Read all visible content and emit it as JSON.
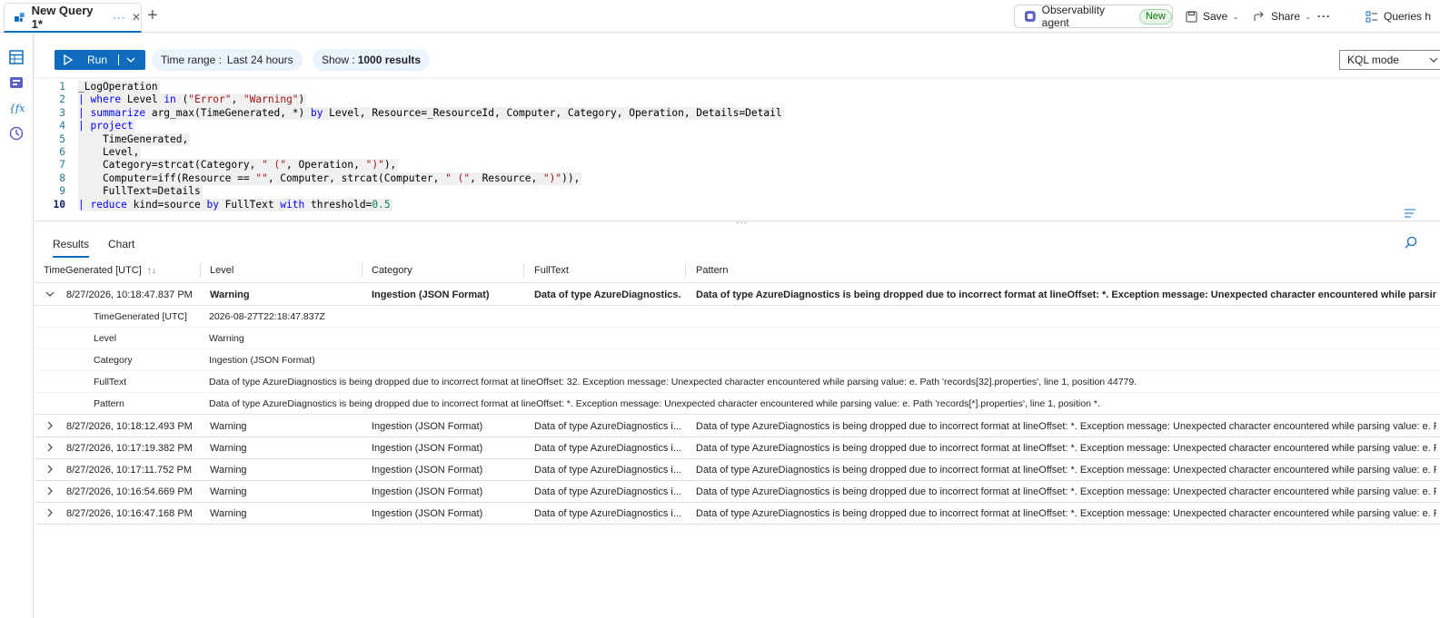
{
  "tab": {
    "title": "New Query 1*",
    "dots": "···",
    "close": "✕",
    "add": "+"
  },
  "header": {
    "agent_label": "Observability agent",
    "agent_badge": "New",
    "save_label": "Save",
    "share_label": "Share",
    "more": "···",
    "queries_label": "Queries h"
  },
  "toolbar": {
    "run_label": "Run",
    "time_range_label": "Time range :",
    "time_range_value": "Last 24 hours",
    "show_label": "Show :",
    "show_value": "1000 results",
    "mode_label": "KQL mode"
  },
  "editor": {
    "line_numbers": [
      "1",
      "2",
      "3",
      "4",
      "5",
      "6",
      "7",
      "8",
      "9",
      "10"
    ]
  },
  "results": {
    "tabs": [
      "Results",
      "Chart"
    ],
    "columns": [
      "TimeGenerated [UTC]",
      "Level",
      "Category",
      "FullText",
      "Pattern"
    ],
    "sort_icon": "↑↓",
    "expanded_row": {
      "time": "8/27/2026, 10:18:47.837 PM",
      "level": "Warning",
      "category": "Ingestion (JSON Format)",
      "fulltext": "Data of type AzureDiagnostics...",
      "pattern": "Data of type AzureDiagnostics is being dropped due to incorrect format at lineOffset: *. Exception message: Unexpected character encountered while parsing valu..."
    },
    "details": [
      {
        "key": "TimeGenerated [UTC]",
        "value": "2026-08-27T22:18:47.837Z"
      },
      {
        "key": "Level",
        "value": "Warning"
      },
      {
        "key": "Category",
        "value": "Ingestion (JSON Format)"
      },
      {
        "key": "FullText",
        "value": "Data of type AzureDiagnostics is being dropped due to incorrect format at lineOffset: 32. Exception message: Unexpected character encountered while parsing value: e. Path 'records[32].properties', line 1, position 44779."
      },
      {
        "key": "Pattern",
        "value": "Data of type AzureDiagnostics is being dropped due to incorrect format at lineOffset: *. Exception message: Unexpected character encountered while parsing value: e. Path 'records[*].properties', line 1, position *."
      }
    ],
    "rows": [
      {
        "time": "8/27/2026, 10:18:12.493 PM",
        "level": "Warning",
        "category": "Ingestion (JSON Format)",
        "fulltext": "Data of type AzureDiagnostics i...",
        "pattern": "Data of type AzureDiagnostics is being dropped due to incorrect format at lineOffset: *. Exception message: Unexpected character encountered while parsing value: e. P..."
      },
      {
        "time": "8/27/2026, 10:17:19.382 PM",
        "level": "Warning",
        "category": "Ingestion (JSON Format)",
        "fulltext": "Data of type AzureDiagnostics i...",
        "pattern": "Data of type AzureDiagnostics is being dropped due to incorrect format at lineOffset: *. Exception message: Unexpected character encountered while parsing value: e. P..."
      },
      {
        "time": "8/27/2026, 10:17:11.752 PM",
        "level": "Warning",
        "category": "Ingestion (JSON Format)",
        "fulltext": "Data of type AzureDiagnostics i...",
        "pattern": "Data of type AzureDiagnostics is being dropped due to incorrect format at lineOffset: *. Exception message: Unexpected character encountered while parsing value: e. P..."
      },
      {
        "time": "8/27/2026, 10:16:54.669 PM",
        "level": "Warning",
        "category": "Ingestion (JSON Format)",
        "fulltext": "Data of type AzureDiagnostics i...",
        "pattern": "Data of type AzureDiagnostics is being dropped due to incorrect format at lineOffset: *. Exception message: Unexpected character encountered while parsing value: e. P..."
      },
      {
        "time": "8/27/2026, 10:16:47.168 PM",
        "level": "Warning",
        "category": "Ingestion (JSON Format)",
        "fulltext": "Data of type AzureDiagnostics i...",
        "pattern": "Data of type AzureDiagnostics is being dropped due to incorrect format at lineOffset: *. Exception message: Unexpected character encountered while parsing value: e. P..."
      }
    ]
  },
  "colors": {
    "accent": "#0f6cbd",
    "keyword": "#0000ff",
    "string": "#a31515",
    "number": "#098658",
    "line_number": "#237893"
  }
}
